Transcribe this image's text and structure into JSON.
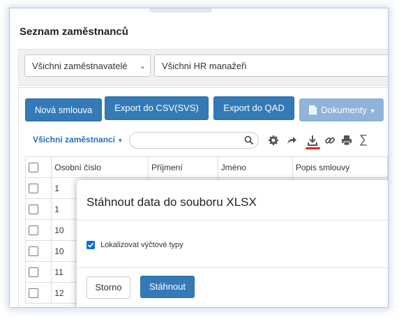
{
  "page": {
    "title": "Seznam zaměstnanců"
  },
  "filters": {
    "employer": "Všichni zaměstnavatelé",
    "hr_manager": "Všichni HR manažeři"
  },
  "actions": {
    "new_contract": "Nová smlouva",
    "export_csv": "Export do CSV(SVS)",
    "export_qad": "Export do QAD",
    "documents": "Dokumenty"
  },
  "toolbar": {
    "view_filter": "Všichni zaměstnanci",
    "icons": [
      "search-icon",
      "gear-icon",
      "share-icon",
      "download-icon",
      "link-icon",
      "print-icon",
      "sum-icon"
    ],
    "highlight_color": "#e0212b"
  },
  "table": {
    "headers": [
      "Osobní číslo",
      "Příjmení",
      "Jméno",
      "Popis smlouvy"
    ],
    "rows": [
      {
        "id": "1"
      },
      {
        "id": "1"
      },
      {
        "id": "10"
      },
      {
        "id": "10"
      },
      {
        "id": "11"
      },
      {
        "id": "12"
      }
    ]
  },
  "modal": {
    "title": "Stáhnout data do souboru XLSX",
    "localize_label": "Lokalizovat výčtové typy",
    "localize_checked": true,
    "cancel": "Storno",
    "download": "Stáhnout"
  },
  "colors": {
    "primary": "#337ab7",
    "disabled": "#8fb3d9",
    "checkbox": "#0b6bd6"
  }
}
